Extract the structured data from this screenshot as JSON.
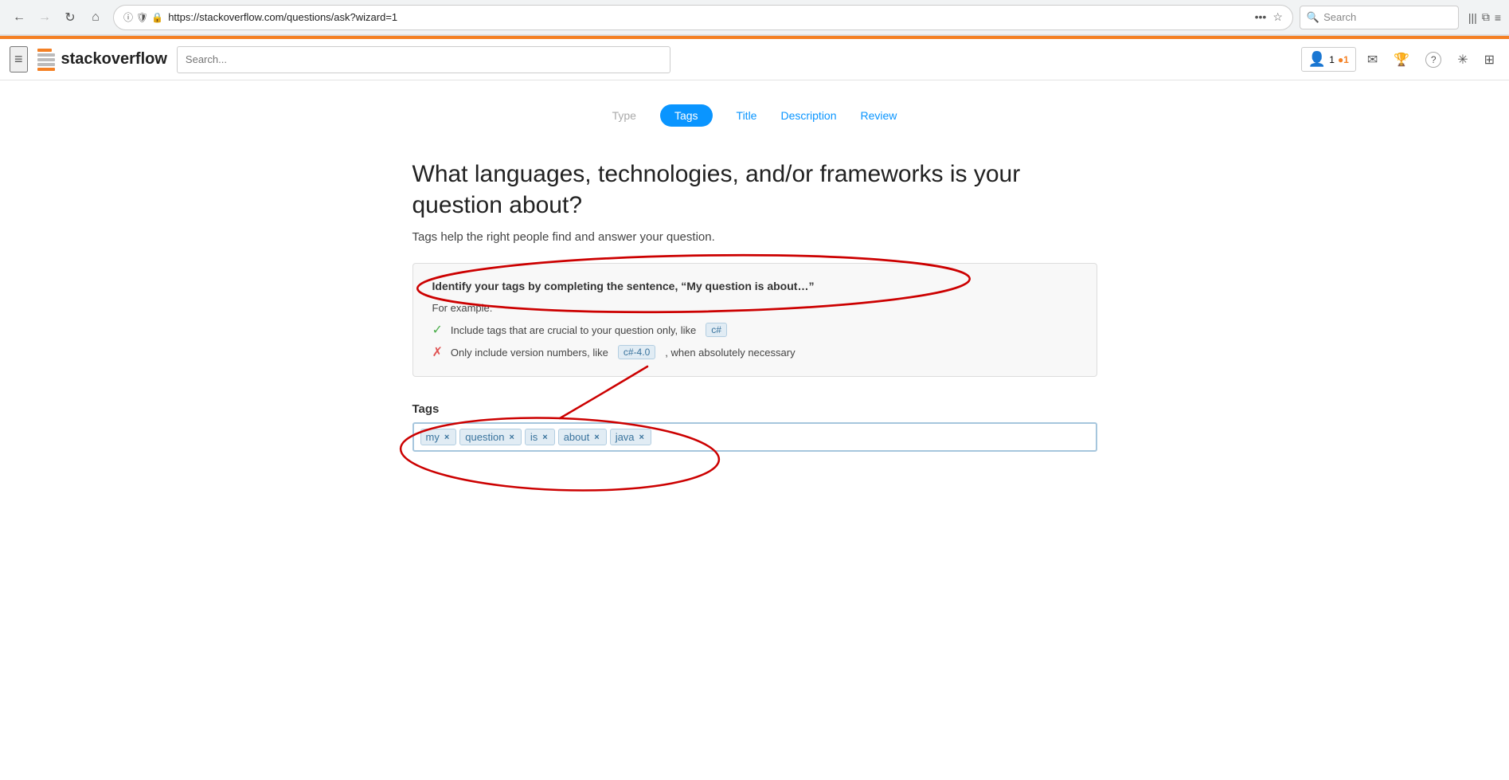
{
  "browser": {
    "back_button": "←",
    "forward_button": "→",
    "reload_button": "↻",
    "home_button": "⌂",
    "url": "https://stackoverflow.com/questions/ask?wizard=1",
    "info_icon": "ⓘ",
    "shield_icon": "🛡",
    "lock_icon": "🔒",
    "bookmark_icon": "☆",
    "more_icon": "•••",
    "search_placeholder": "Search",
    "library_icon": "|||",
    "tabs_icon": "⧉",
    "menu_icon": "≡"
  },
  "so_header": {
    "hamburger": "≡",
    "logo_text_stack": "stack",
    "logo_text_overflow": "overflow",
    "search_placeholder": "Search...",
    "reputation": "1",
    "rep_dot": "●1",
    "inbox_icon": "✉",
    "trophy_icon": "🏆",
    "help_icon": "?",
    "snowflake_icon": "✳",
    "grid_icon": "⊞"
  },
  "wizard": {
    "steps": [
      {
        "label": "Type",
        "state": "inactive"
      },
      {
        "label": "Tags",
        "state": "active"
      },
      {
        "label": "Title",
        "state": "clickable"
      },
      {
        "label": "Description",
        "state": "clickable"
      },
      {
        "label": "Review",
        "state": "clickable"
      }
    ]
  },
  "main": {
    "heading": "What languages, technologies, and/or frameworks is your question about?",
    "subtext": "Tags help the right people find and answer your question.",
    "instruction": {
      "title": "Identify your tags by completing the sentence, “My question is about…”",
      "example_label": "For example:",
      "items": [
        {
          "type": "check",
          "text": "Include tags that are crucial to your question only, like",
          "tag": "c#"
        },
        {
          "type": "x",
          "text": "Only include version numbers, like",
          "tag": "c#-4.0",
          "text_after": ", when absolutely necessary"
        }
      ]
    },
    "tags_section": {
      "label": "Tags",
      "tags": [
        {
          "name": "my"
        },
        {
          "name": "question"
        },
        {
          "name": "is"
        },
        {
          "name": "about"
        },
        {
          "name": "java"
        }
      ]
    }
  }
}
